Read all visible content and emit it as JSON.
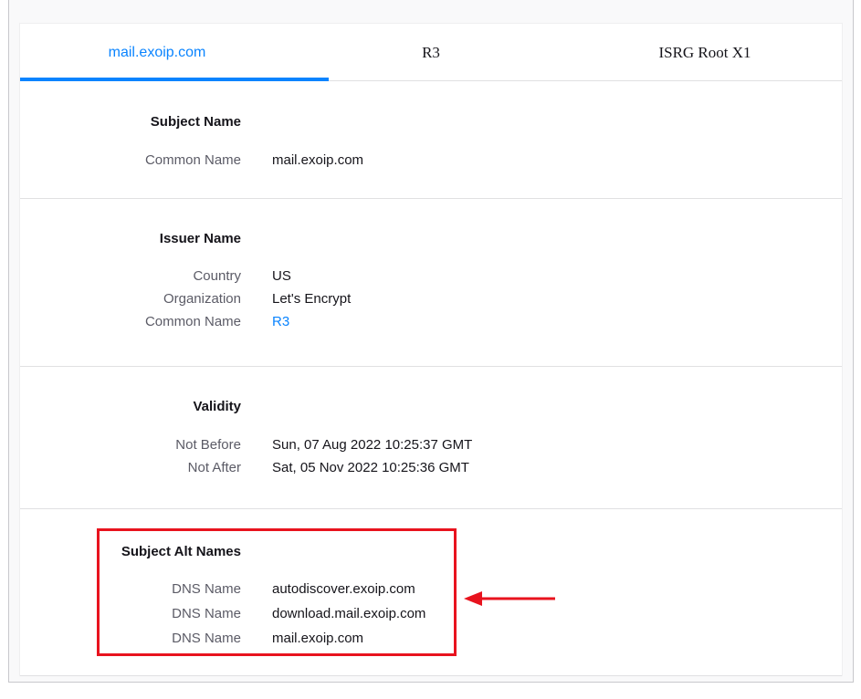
{
  "tabs": [
    {
      "label": "mail.exoip.com",
      "active": true
    },
    {
      "label": "R3",
      "active": false
    },
    {
      "label": "ISRG Root X1",
      "active": false
    }
  ],
  "subject_name": {
    "title": "Subject Name",
    "rows": [
      {
        "key": "Common Name",
        "value": "mail.exoip.com"
      }
    ]
  },
  "issuer_name": {
    "title": "Issuer Name",
    "rows": [
      {
        "key": "Country",
        "value": "US"
      },
      {
        "key": "Organization",
        "value": "Let's Encrypt"
      },
      {
        "key": "Common Name",
        "value": "R3"
      }
    ]
  },
  "validity": {
    "title": "Validity",
    "rows": [
      {
        "key": "Not Before",
        "value": "Sun, 07 Aug 2022 10:25:37 GMT"
      },
      {
        "key": "Not After",
        "value": "Sat, 05 Nov 2022 10:25:36 GMT"
      }
    ]
  },
  "subject_alt_names": {
    "title": "Subject Alt Names",
    "rows": [
      {
        "key": "DNS Name",
        "value": "autodiscover.exoip.com"
      },
      {
        "key": "DNS Name",
        "value": "download.mail.exoip.com"
      },
      {
        "key": "DNS Name",
        "value": "mail.exoip.com"
      }
    ]
  },
  "colors": {
    "accent": "#0a84ff",
    "highlight": "#e8131e"
  }
}
